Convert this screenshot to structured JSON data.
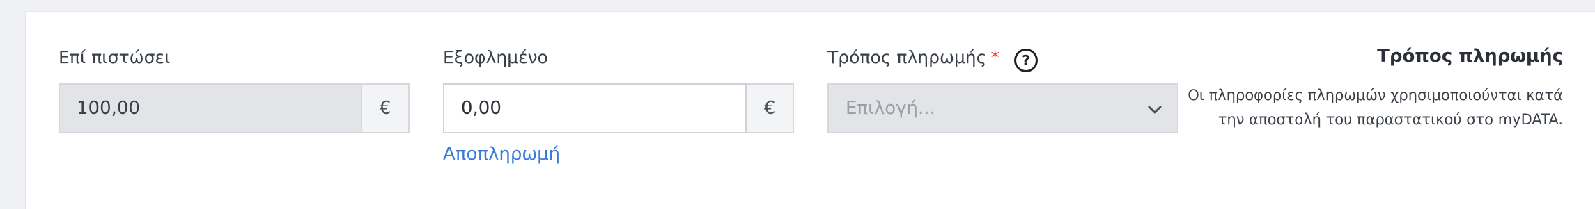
{
  "credit": {
    "label": "Επί πιστώσει",
    "value": "100,00",
    "currency": "€"
  },
  "paid": {
    "label": "Εξοφλημένο",
    "value": "0,00",
    "currency": "€",
    "repayment_link": "Αποπληρωμή"
  },
  "payment_method": {
    "label": "Τρόπος πληρωμής",
    "required_mark": "*",
    "help_glyph": "?",
    "placeholder": "Επιλογή..."
  },
  "info": {
    "title": "Τρόπος πληρωμής",
    "text": "Οι πληροφορίες πληρωμών χρησιμοποιούνται κατά την αποστολή του παραστατικού στο myDATA."
  },
  "colors": {
    "link": "#3a7bd5",
    "required": "#e0463c",
    "disabled_bg": "#e3e4e8",
    "page_bg": "#f0f1f5"
  }
}
